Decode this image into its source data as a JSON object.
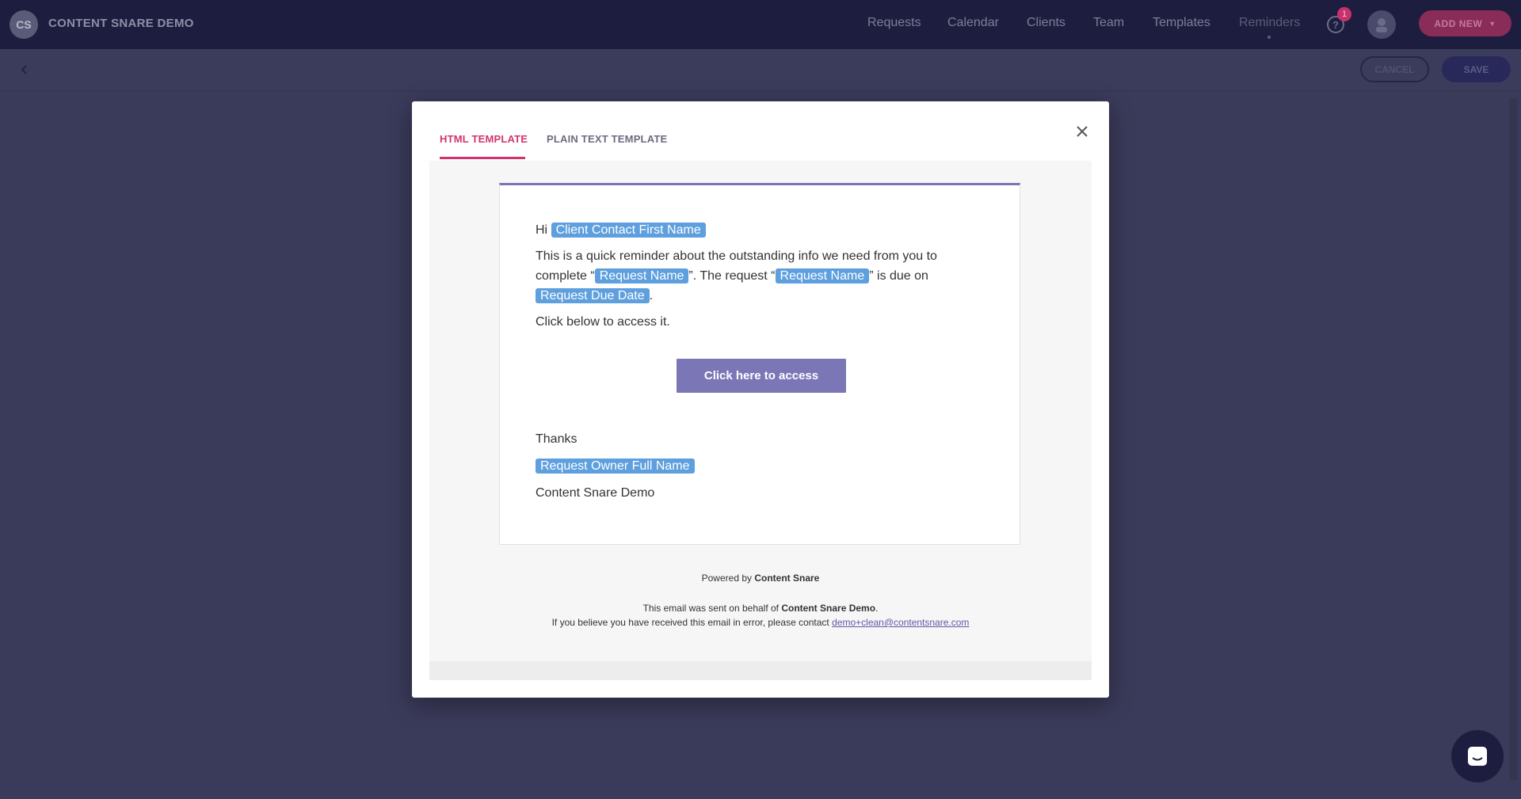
{
  "app": {
    "logo_initials": "CS",
    "brand": "CONTENT SNARE DEMO"
  },
  "nav": {
    "items": [
      "Requests",
      "Calendar",
      "Clients",
      "Team",
      "Templates",
      "Reminders"
    ],
    "notification_count": "1",
    "add_new_label": "ADD NEW"
  },
  "toolbar": {
    "cancel_label": "CANCEL",
    "save_label": "SAVE"
  },
  "modal": {
    "tabs": [
      "HTML TEMPLATE",
      "PLAIN TEXT TEMPLATE"
    ],
    "active_tab": "HTML TEMPLATE",
    "email": {
      "greeting": "Hi",
      "tag_first_name": "Client Contact First Name",
      "line1_a": "This is a quick reminder about the outstanding info we need from you to complete “",
      "tag_request_name": "Request Name",
      "line1_b": "”. The request “",
      "line1_c": "” is due on",
      "tag_due_date": "Request Due Date",
      "line1_end": ".",
      "line2": "Click below to access it.",
      "cta_label": "Click here to access",
      "thanks": "Thanks",
      "tag_owner": "Request Owner Full Name",
      "company": "Content Snare Demo"
    },
    "footer": {
      "powered_by": "Powered by",
      "powered_brand": "Content Snare",
      "sent_prefix": "This email was sent on behalf of",
      "sent_company": "Content Snare Demo",
      "sent_suffix": ".",
      "error_text": "If you believe you have received this email in error, please contact",
      "contact_email": "demo+clean@contentsnare.com"
    }
  },
  "colors": {
    "accent_pink": "#d2336e",
    "tag_blue": "#5e9fde",
    "button_purple": "#7b76b6",
    "header_navy": "#1d1e3f"
  }
}
